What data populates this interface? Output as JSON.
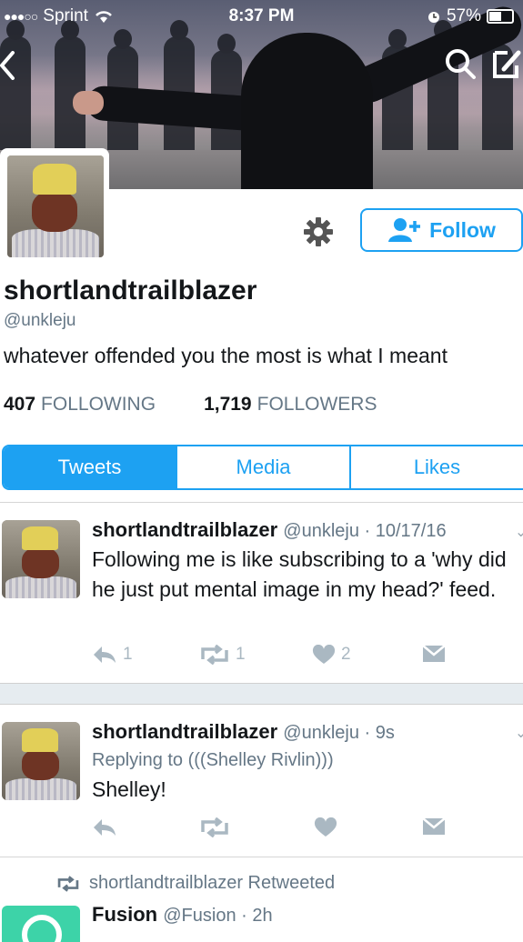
{
  "status_bar": {
    "carrier": "Sprint",
    "time": "8:37 PM",
    "battery": "57%"
  },
  "profile": {
    "name": "shortlandtrailblazer",
    "handle": "@unkleju",
    "bio": "whatever offended you the most is what I meant",
    "following_count": "407",
    "following_label": "FOLLOWING",
    "followers_count": "1,719",
    "followers_label": "FOLLOWERS",
    "follow_label": "Follow"
  },
  "tabs": [
    {
      "label": "Tweets",
      "active": true
    },
    {
      "label": "Media",
      "active": false
    },
    {
      "label": "Likes",
      "active": false
    }
  ],
  "tweets": [
    {
      "name": "shortlandtrailblazer",
      "meta": "@unkleju · 10/17/16",
      "text": "Following me is like subscribing to a 'why did he just put mental image in my head?' feed.",
      "reply_count": "1",
      "retweet_count": "1",
      "like_count": "2"
    },
    {
      "name": "shortlandtrailblazer",
      "meta": "@unkleju · 9s",
      "replying_to": "Replying to (((Shelley Rivlin)))",
      "text": "Shelley!"
    }
  ],
  "retweet_notice": "shortlandtrailblazer Retweeted",
  "retweeted": {
    "name": "Fusion",
    "meta": "@Fusion · 2h"
  },
  "colors": {
    "accent": "#1da1f2",
    "muted": "#657786",
    "icon_gray": "#aab8c2",
    "fusion_brand": "#3dd3a8"
  },
  "icons": [
    "wifi-icon",
    "alarm-icon",
    "battery-icon",
    "back-chevron-icon",
    "search-icon",
    "compose-icon",
    "gear-icon",
    "add-user-icon",
    "reply-icon",
    "retweet-icon",
    "like-icon",
    "dm-icon",
    "chevron-down-icon"
  ]
}
